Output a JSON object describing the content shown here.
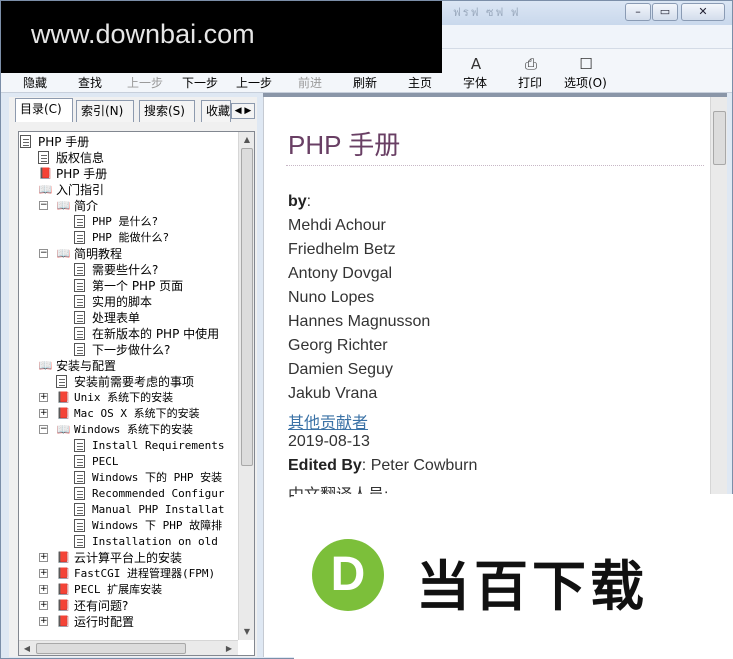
{
  "watermark": {
    "text": "www.downbai.com"
  },
  "window": {
    "title_faint": "ฟรฟ  ซฟ  ฟ",
    "buttons": {
      "minimize": "–",
      "maximize": "▭",
      "close": "✕"
    }
  },
  "toolbar": {
    "items": [
      {
        "label": "隐藏",
        "enabled": true
      },
      {
        "label": "查找",
        "enabled": true
      },
      {
        "label": "上一步",
        "enabled": false
      },
      {
        "label": "下一步",
        "enabled": true
      },
      {
        "label": "上一步",
        "enabled": true
      },
      {
        "label": "前进",
        "enabled": false
      },
      {
        "label": "刷新",
        "enabled": true
      },
      {
        "label": "主页",
        "enabled": true
      },
      {
        "label": "字体",
        "enabled": true
      },
      {
        "label": "打印",
        "enabled": true
      },
      {
        "label": "选项(O)",
        "enabled": true
      }
    ],
    "icons": [
      "font-icon",
      "print-icon",
      "options-icon"
    ]
  },
  "tabs": [
    {
      "label": "目录(C)",
      "active": true
    },
    {
      "label": "索引(N)",
      "active": false
    },
    {
      "label": "搜索(S)",
      "active": false
    },
    {
      "label": "收藏",
      "active": false
    }
  ],
  "tree": [
    {
      "label": "PHP 手册",
      "depth": 0,
      "icon": "page",
      "expander": ""
    },
    {
      "label": "版权信息",
      "depth": 1,
      "icon": "page",
      "expander": ""
    },
    {
      "label": "PHP 手册",
      "depth": 1,
      "icon": "book",
      "expander": ""
    },
    {
      "label": "入门指引",
      "depth": 1,
      "icon": "obook",
      "expander": ""
    },
    {
      "label": "简介",
      "depth": 2,
      "icon": "obook",
      "expander": "−"
    },
    {
      "label": "PHP 是什么?",
      "depth": 3,
      "icon": "page",
      "expander": ""
    },
    {
      "label": "PHP 能做什么?",
      "depth": 3,
      "icon": "page",
      "expander": ""
    },
    {
      "label": "简明教程",
      "depth": 2,
      "icon": "obook",
      "expander": "−"
    },
    {
      "label": "需要些什么?",
      "depth": 3,
      "icon": "page",
      "expander": ""
    },
    {
      "label": "第一个 PHP 页面",
      "depth": 3,
      "icon": "page",
      "expander": ""
    },
    {
      "label": "实用的脚本",
      "depth": 3,
      "icon": "page",
      "expander": ""
    },
    {
      "label": "处理表单",
      "depth": 3,
      "icon": "page",
      "expander": ""
    },
    {
      "label": "在新版本的 PHP 中使用",
      "depth": 3,
      "icon": "page",
      "expander": ""
    },
    {
      "label": "下一步做什么?",
      "depth": 3,
      "icon": "page",
      "expander": ""
    },
    {
      "label": "安装与配置",
      "depth": 1,
      "icon": "obook",
      "expander": ""
    },
    {
      "label": "安装前需要考虑的事项",
      "depth": 2,
      "icon": "page",
      "expander": ""
    },
    {
      "label": "Unix 系统下的安装",
      "depth": 2,
      "icon": "book",
      "expander": "+"
    },
    {
      "label": "Mac OS X 系统下的安装",
      "depth": 2,
      "icon": "book",
      "expander": "+"
    },
    {
      "label": "Windows 系统下的安装",
      "depth": 2,
      "icon": "obook",
      "expander": "−"
    },
    {
      "label": "Install Requirements",
      "depth": 3,
      "icon": "page",
      "expander": ""
    },
    {
      "label": "PECL",
      "depth": 3,
      "icon": "page",
      "expander": ""
    },
    {
      "label": "Windows 下的 PHP 安装",
      "depth": 3,
      "icon": "page",
      "expander": ""
    },
    {
      "label": "Recommended Configur",
      "depth": 3,
      "icon": "page",
      "expander": ""
    },
    {
      "label": "Manual PHP Installat",
      "depth": 3,
      "icon": "page",
      "expander": ""
    },
    {
      "label": "Windows 下 PHP 故障排",
      "depth": 3,
      "icon": "page",
      "expander": ""
    },
    {
      "label": "Installation on old",
      "depth": 3,
      "icon": "page",
      "expander": ""
    },
    {
      "label": "云计算平台上的安装",
      "depth": 2,
      "icon": "book",
      "expander": "+"
    },
    {
      "label": "FastCGI 进程管理器(FPM)",
      "depth": 2,
      "icon": "book",
      "expander": "+"
    },
    {
      "label": "PECL 扩展库安装",
      "depth": 2,
      "icon": "book",
      "expander": "+"
    },
    {
      "label": "还有问题?",
      "depth": 2,
      "icon": "book",
      "expander": "+"
    },
    {
      "label": "运行时配置",
      "depth": 2,
      "icon": "book",
      "expander": "+"
    }
  ],
  "content": {
    "title": "PHP 手册",
    "by_label": "by",
    "by_colon": ":",
    "authors": [
      "Mehdi Achour",
      "Friedhelm Betz",
      "Antony Dovgal",
      "Nuno Lopes",
      "Hannes Magnusson",
      "Georg Richter",
      "Damien Seguy",
      "Jakub Vrana"
    ],
    "other_contributors_link": "其他贡献者",
    "date": "2019-08-13",
    "edited_by_label": "Edited By",
    "edited_by_value": ": Peter Cowburn",
    "translators_label": "中文翻译人员:"
  },
  "overlay": {
    "logo_letter": "D",
    "logo_text": "当百下载",
    "logo_color": "#7cbf3a"
  }
}
